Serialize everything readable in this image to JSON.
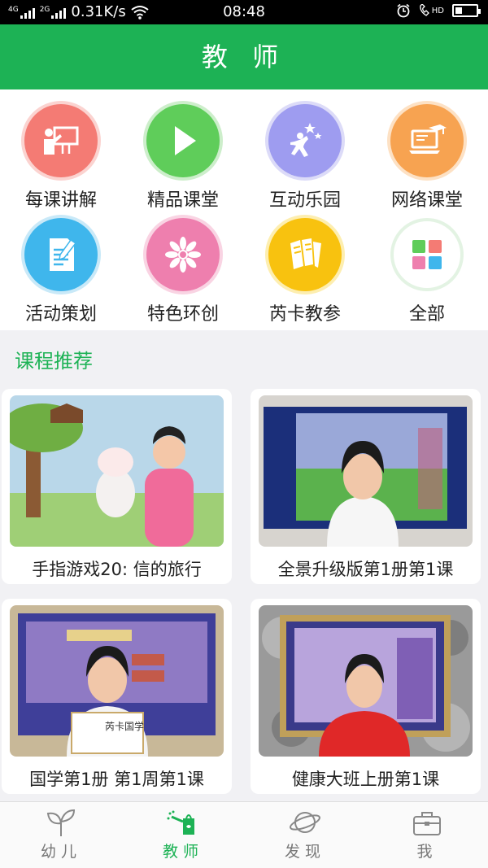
{
  "status_bar": {
    "network_speed": "0.31K/s",
    "time": "08:48",
    "sig1": "4G",
    "sig2": "2G",
    "volte": "HD"
  },
  "header": {
    "title": "教 师"
  },
  "grid": [
    {
      "label": "每课讲解",
      "icon": "teacher-board-icon",
      "color": "#f47b74"
    },
    {
      "label": "精品课堂",
      "icon": "play-icon",
      "color": "#5fcd5a"
    },
    {
      "label": "互动乐园",
      "icon": "stars-person-icon",
      "color": "#9e9cf0"
    },
    {
      "label": "网络课堂",
      "icon": "graduation-laptop-icon",
      "color": "#f7a351"
    },
    {
      "label": "活动策划",
      "icon": "document-pen-icon",
      "color": "#3fb6ec"
    },
    {
      "label": "特色环创",
      "icon": "flower-icon",
      "color": "#ee7fae"
    },
    {
      "label": "芮卡教参",
      "icon": "books-icon",
      "color": "#f8c20f"
    },
    {
      "label": "全部",
      "icon": "all-tiles-icon",
      "color": "#ffffff"
    }
  ],
  "section": {
    "title": "课程推荐"
  },
  "courses": [
    {
      "title": "手指游戏20: 信的旅行"
    },
    {
      "title": "全景升级版第1册第1课"
    },
    {
      "title": "国学第1册  第1周第1课",
      "book_title": "芮卡国学"
    },
    {
      "title": "健康大班上册第1课"
    }
  ],
  "tabs": [
    {
      "label": "幼儿",
      "icon": "sprout-icon",
      "active": false
    },
    {
      "label": "教师",
      "icon": "watering-can-icon",
      "active": true
    },
    {
      "label": "发现",
      "icon": "planet-icon",
      "active": false
    },
    {
      "label": "我",
      "icon": "briefcase-icon",
      "active": false
    }
  ],
  "colors": {
    "brand": "#1db255",
    "text": "#222222",
    "tab_inactive": "#777777"
  }
}
